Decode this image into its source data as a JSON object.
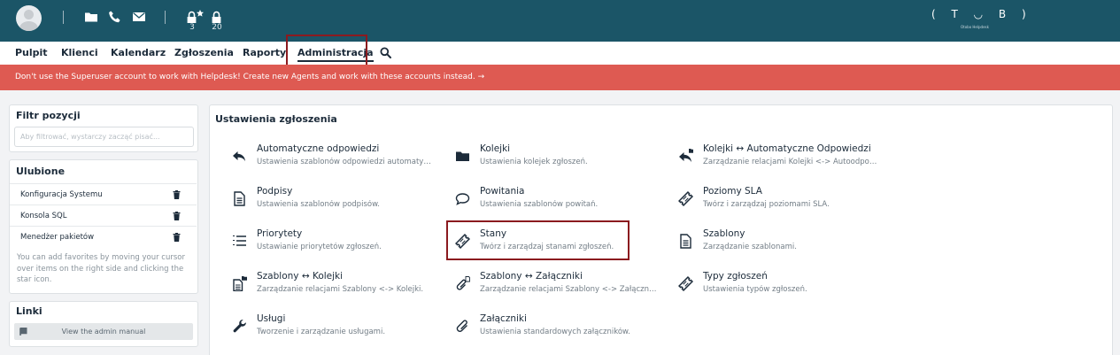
{
  "topbar": {
    "icons": [
      "user-avatar",
      "folder-icon",
      "phone-icon",
      "envelope-icon",
      "lock-star-icon",
      "lock-icon"
    ],
    "locked_with_star_count": "3",
    "locked_count": "20",
    "logo": {
      "mark": "( T ◡ B )",
      "sub": "Otobo Helpdesk"
    }
  },
  "nav": {
    "items": [
      {
        "label": "Pulpit"
      },
      {
        "label": "Klienci"
      },
      {
        "label": "Kalendarz"
      },
      {
        "label": "Zgłoszenia"
      },
      {
        "label": "Raporty"
      },
      {
        "label": "Administracja"
      }
    ],
    "active": "Administracja",
    "search_icon": "search-icon"
  },
  "banner": {
    "text": "Don't use the Superuser account to work with Helpdesk! Create new Agents and work with these accounts instead. →",
    "color": "#de5a52"
  },
  "sidebar": {
    "filter": {
      "title": "Filtr pozycji",
      "placeholder": "Aby filtrować, wystarczy zacząć pisać...",
      "value": ""
    },
    "favourites": {
      "title": "Ulubione",
      "items": [
        {
          "label": "Konfiguracja Systemu"
        },
        {
          "label": "Konsola SQL"
        },
        {
          "label": "Menedżer pakietów"
        }
      ],
      "help": "You can add favorites by moving your cursor over items on the right side and clicking the star icon."
    },
    "links": {
      "title": "Linki",
      "manual_label": "View the admin manual"
    }
  },
  "main": {
    "title": "Ustawienia zgłoszenia",
    "items": [
      {
        "title": "Automatyczne odpowiedzi",
        "desc": "Ustawienia szablonów odpowiedzi automatycznych.",
        "icon": "reply-icon"
      },
      {
        "title": "Kolejki",
        "desc": "Ustawienia kolejek zgłoszeń.",
        "icon": "folder-icon"
      },
      {
        "title": "Kolejki ↔ Automatyczne Odpowiedzi",
        "desc": "Zarządzanie relacjami Kolejki <-> Autoodpowiedzi.",
        "icon": "reply-folder-icon"
      },
      {
        "title": "Podpisy",
        "desc": "Ustawienia szablonów podpisów.",
        "icon": "document-icon"
      },
      {
        "title": "Powitania",
        "desc": "Ustawienia szablonów powitań.",
        "icon": "comment-icon"
      },
      {
        "title": "Poziomy SLA",
        "desc": "Twórz i zarządzaj poziomami SLA.",
        "icon": "ticket-icon"
      },
      {
        "title": "Priorytety",
        "desc": "Ustawianie priorytetów zgłoszeń.",
        "icon": "list-ordered-icon"
      },
      {
        "title": "Stany",
        "desc": "Twórz i zarządzaj stanami zgłoszeń.",
        "icon": "ticket-icon"
      },
      {
        "title": "Szablony",
        "desc": "Zarządzanie szablonami.",
        "icon": "document-icon"
      },
      {
        "title": "Szablony ↔ Kolejki",
        "desc": "Zarządzanie relacjami Szablony <-> Kolejki.",
        "icon": "document-folder-icon"
      },
      {
        "title": "Szablony ↔ Załączniki",
        "desc": "Zarządzanie relacjami Szablony <-> Załączniki.",
        "icon": "paperclip-document-icon"
      },
      {
        "title": "Typy zgłoszeń",
        "desc": "Ustawienia typów zgłoszeń.",
        "icon": "ticket-icon"
      },
      {
        "title": "Usługi",
        "desc": "Tworzenie i zarządzanie usługami.",
        "icon": "wrench-icon"
      },
      {
        "title": "Załączniki",
        "desc": "Ustawienia standardowych załączników.",
        "icon": "paperclip-icon"
      }
    ]
  }
}
